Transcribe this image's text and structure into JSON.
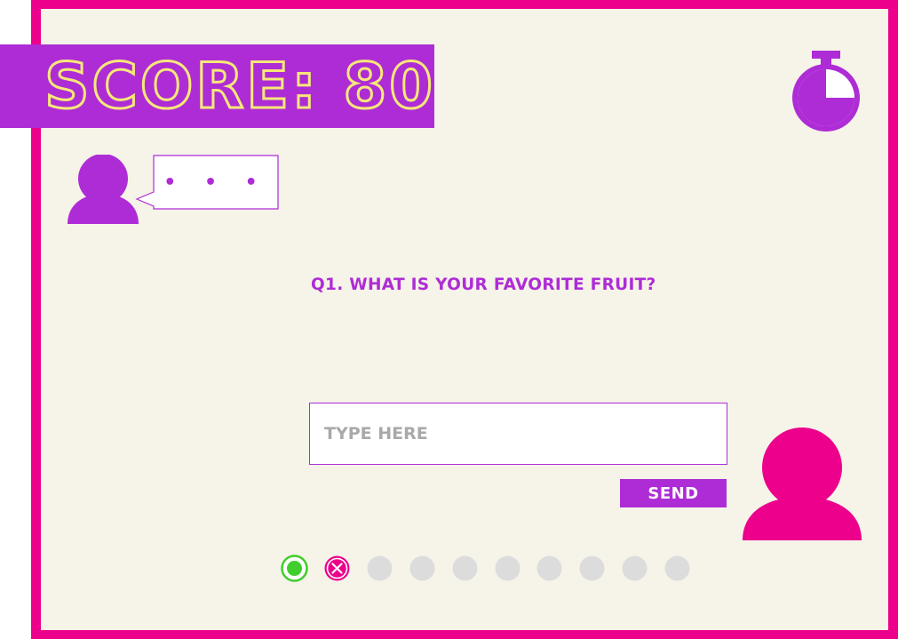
{
  "score": {
    "label": "SCORE:",
    "value": "80"
  },
  "timer": {
    "icon": "stopwatch-icon",
    "elapsed_fraction": 0.25
  },
  "chat": {
    "bot_message": "• • •",
    "icon": "user-icon"
  },
  "question": {
    "text": "Q1. WHAT IS YOUR FAVORITE FRUIT?"
  },
  "answer": {
    "placeholder": "TYPE HERE",
    "value": ""
  },
  "send": {
    "label": "SEND"
  },
  "progress": {
    "items": [
      "correct",
      "wrong",
      "pending",
      "pending",
      "pending",
      "pending",
      "pending",
      "pending",
      "pending",
      "pending"
    ]
  },
  "colors": {
    "primary": "#ae2cd6",
    "accent": "#ec008c",
    "background": "#f6f3e8",
    "score_text": "#f6e879",
    "correct": "#3fce2b",
    "wrong": "#ec008c",
    "pending": "#dcdcdc"
  }
}
